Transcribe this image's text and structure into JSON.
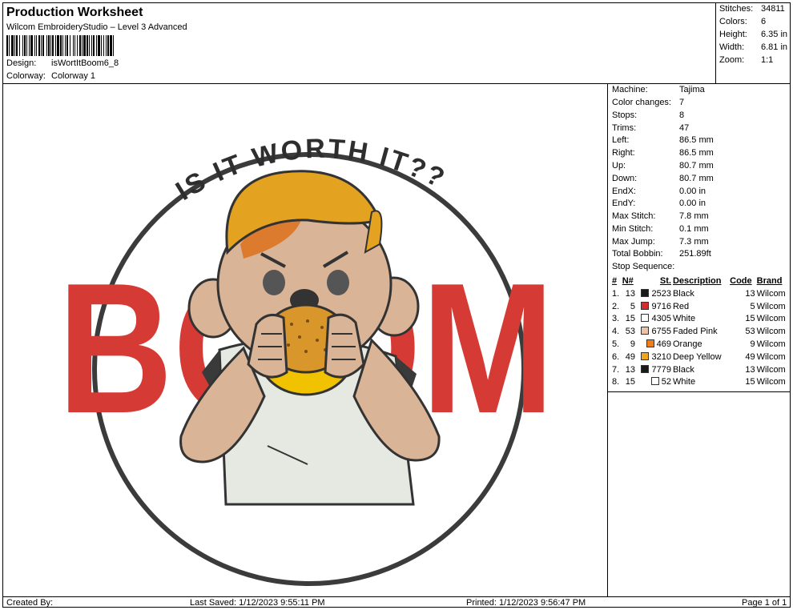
{
  "header": {
    "title": "Production Worksheet",
    "subtitle": "Wilcom EmbroideryStudio – Level 3 Advanced",
    "design_label": "Design:",
    "design_value": "isWortItBoom6_8",
    "colorway_label": "Colorway:",
    "colorway_value": "Colorway 1"
  },
  "summary": [
    {
      "label": "Stitches:",
      "value": "34811"
    },
    {
      "label": "Colors:",
      "value": "6"
    },
    {
      "label": "Height:",
      "value": "6.35 in"
    },
    {
      "label": "Width:",
      "value": "6.81 in"
    },
    {
      "label": "Zoom:",
      "value": "1:1"
    }
  ],
  "machine": [
    {
      "label": "Machine:",
      "value": "Tajima"
    },
    {
      "label": "Color changes:",
      "value": "7"
    },
    {
      "label": "Stops:",
      "value": "8"
    },
    {
      "label": "Trims:",
      "value": "47"
    },
    {
      "label": "Left:",
      "value": "86.5 mm"
    },
    {
      "label": "Right:",
      "value": "86.5 mm"
    },
    {
      "label": "Up:",
      "value": "80.7 mm"
    },
    {
      "label": "Down:",
      "value": "80.7 mm"
    },
    {
      "label": "EndX:",
      "value": "0.00 in"
    },
    {
      "label": "EndY:",
      "value": "0.00 in"
    },
    {
      "label": "Max Stitch:",
      "value": "7.8 mm"
    },
    {
      "label": "Min Stitch:",
      "value": "0.1 mm"
    },
    {
      "label": "Max Jump:",
      "value": "7.3 mm"
    },
    {
      "label": "Total Bobbin:",
      "value": "251.89ft"
    }
  ],
  "stop_sequence": {
    "title": "Stop Sequence:",
    "columns": [
      "#",
      "N#",
      "St.",
      "Description",
      "Code",
      "Brand"
    ],
    "rows": [
      {
        "num": "1.",
        "n": "13",
        "color": "#1a1a1a",
        "st": "2523",
        "desc": "Black",
        "code": "13",
        "brand": "Wilcom"
      },
      {
        "num": "2.",
        "n": "5",
        "color": "#d42b2b",
        "st": "9716",
        "desc": "Red",
        "code": "5",
        "brand": "Wilcom"
      },
      {
        "num": "3.",
        "n": "15",
        "color": "#ffffff",
        "st": "4305",
        "desc": "White",
        "code": "15",
        "brand": "Wilcom"
      },
      {
        "num": "4.",
        "n": "53",
        "color": "#e9c2a8",
        "st": "6755",
        "desc": "Faded Pink",
        "code": "53",
        "brand": "Wilcom"
      },
      {
        "num": "5.",
        "n": "9",
        "color": "#ee7d1b",
        "st": "469",
        "desc": "Orange",
        "code": "9",
        "brand": "Wilcom"
      },
      {
        "num": "6.",
        "n": "49",
        "color": "#f0a61a",
        "st": "3210",
        "desc": "Deep Yellow",
        "code": "49",
        "brand": "Wilcom"
      },
      {
        "num": "7.",
        "n": "13",
        "color": "#1a1a1a",
        "st": "7779",
        "desc": "Black",
        "code": "13",
        "brand": "Wilcom"
      },
      {
        "num": "8.",
        "n": "15",
        "color": "#ffffff",
        "st": "52",
        "desc": "White",
        "code": "15",
        "brand": "Wilcom"
      }
    ]
  },
  "design": {
    "arc_text": "IS IT WORTH IT??",
    "big_text": "BOOM",
    "colors": {
      "red": "#d63a35",
      "black": "#3a3a3a",
      "skin": "#d9b496",
      "yellow": "#e3a21f",
      "orange": "#dc7a2e",
      "shirt": "#e6e8e2"
    }
  },
  "footer": {
    "created": "Created By:",
    "saved": "Last Saved: 1/12/2023 9:55:11 PM",
    "printed": "Printed: 1/12/2023 9:56:47 PM",
    "page": "Page 1 of 1"
  }
}
